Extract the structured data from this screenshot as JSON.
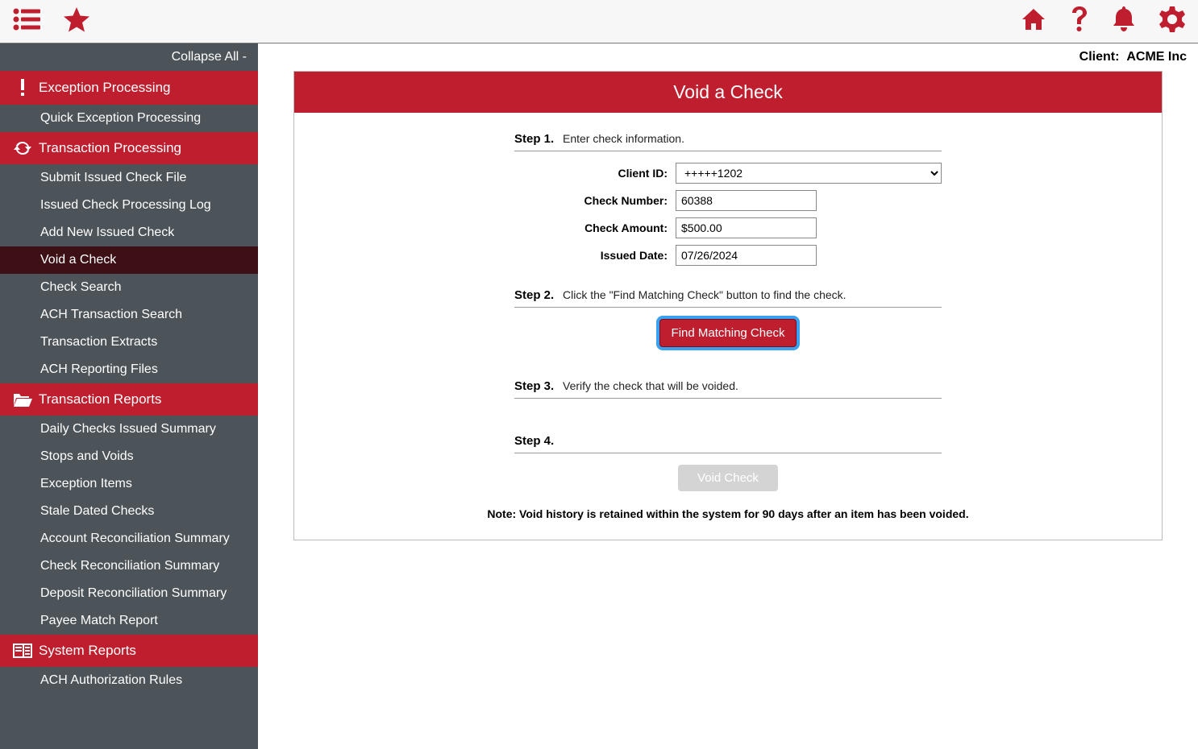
{
  "client_label": "Client:",
  "client_name": "ACME Inc",
  "sidebar": {
    "collapse_all": "Collapse All -",
    "sections": [
      {
        "title": "Exception Processing",
        "items": [
          "Quick Exception Processing"
        ]
      },
      {
        "title": "Transaction Processing",
        "items": [
          "Submit Issued Check File",
          "Issued Check Processing Log",
          "Add New Issued Check",
          "Void a Check",
          "Check Search",
          "ACH Transaction Search",
          "Transaction Extracts",
          "ACH Reporting Files"
        ],
        "active": "Void a Check"
      },
      {
        "title": "Transaction Reports",
        "items": [
          "Daily Checks Issued Summary",
          "Stops and Voids",
          "Exception Items",
          "Stale Dated Checks",
          "Account Reconciliation Summary",
          "Check Reconciliation Summary",
          "Deposit Reconciliation Summary",
          "Payee Match Report"
        ]
      },
      {
        "title": "System Reports",
        "items": [
          "ACH Authorization Rules"
        ]
      }
    ]
  },
  "page": {
    "title": "Void a Check",
    "steps": [
      {
        "label": "Step 1.",
        "text": "Enter check information."
      },
      {
        "label": "Step 2.",
        "text": "Click the \"Find Matching Check\" button to find the check."
      },
      {
        "label": "Step 3.",
        "text": "Verify the check that will be voided."
      },
      {
        "label": "Step 4.",
        "text": ""
      }
    ],
    "form": {
      "client_id_label": "Client ID:",
      "client_id_value": "+++++1202",
      "check_number_label": "Check Number:",
      "check_number_value": "60388",
      "check_amount_label": "Check Amount:",
      "check_amount_value": "$500.00",
      "issued_date_label": "Issued Date:",
      "issued_date_value": "07/26/2024"
    },
    "find_button": "Find Matching Check",
    "void_button": "Void Check",
    "note": "Note: Void history is retained within the system for 90 days after an item has been voided."
  }
}
